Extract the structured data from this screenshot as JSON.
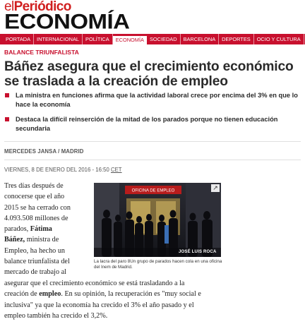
{
  "masthead": {
    "logo_prefix": "el",
    "logo_main": "Periódico",
    "section": "ECONOMÍA"
  },
  "nav": {
    "items": [
      "PORTADA",
      "INTERNACIONAL",
      "POLÍTICA",
      "ECONOMÍA",
      "SOCIEDAD",
      "BARCELONA",
      "DEPORTES",
      "OCIO Y CULTURA",
      "GE"
    ],
    "active": "ECONOMÍA"
  },
  "article": {
    "kicker": "BALANCE TRIUNFALISTA",
    "headline": "Báñez asegura que el crecimiento económico se traslada a la creación de empleo",
    "subheads": [
      "La ministra en funciones afirma que la actividad laboral crece por encima del 3% en que lo hace la economía",
      "Destaca la difícil reinserción de la mitad de los parados porque no tienen educación secundaria"
    ],
    "author": "MERCEDES JANSA / MADRID",
    "date": "VIERNES, 8 DE ENERO DEL 2016 - 16:50",
    "timezone": "CET",
    "body_left": [
      "Tres días después de",
      "conocerse que el año",
      "2015 se ha cerrado con",
      "4.093.508 millones de",
      "parados, ",
      "Fátima",
      "Báñez,",
      " ministra de",
      "Empleo, ha hecho un",
      "balance triunfalista del",
      "mercado de trabajo al"
    ],
    "body_full": [
      "asegurar que el crecimiento económico se está trasladando a la",
      "creación de ",
      "empleo",
      ". En su opinión, la recuperación es \"muy social e",
      "inclusiva\" ya que la economía ha crecido el 3% el año pasado y el",
      "empleo también ha crecido el 3,2%."
    ]
  },
  "photo": {
    "sign_text": "OFICINA DE EMPLEO",
    "credit": "JOSÉ LUIS ROCA",
    "caption": "La lacra del paro 8Un grupo de parados hacen cola en una oficina del Inem de Madrid.",
    "expand_icon": "expand-icon"
  },
  "colors": {
    "brand_red": "#c8102e",
    "headline": "#2a2a2a"
  }
}
